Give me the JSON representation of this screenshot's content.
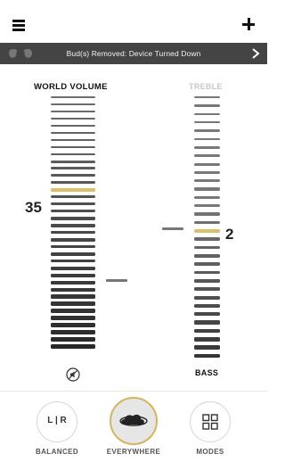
{
  "banner": {
    "text": "Bud(s) Removed: Device Turned Down"
  },
  "volume": {
    "label": "WORLD VOLUME",
    "value": "35",
    "bar_count": 36,
    "selected_index": 13
  },
  "eq": {
    "treble_label": "TREBLE",
    "bass_label": "BASS",
    "value": "2",
    "bar_count": 32,
    "selected_index": 16
  },
  "modes": [
    {
      "label": "BALANCED",
      "icon": "balance-lr-icon",
      "glyph": "L | R"
    },
    {
      "label": "EVERYWHERE",
      "icon": "everywhere-cloud-icon",
      "active": true
    },
    {
      "label": "MODES",
      "icon": "grid-icon"
    }
  ],
  "colors": {
    "accent": "#dcc067",
    "banner_bg": "#444444",
    "active_ring": "#d6b45a"
  }
}
